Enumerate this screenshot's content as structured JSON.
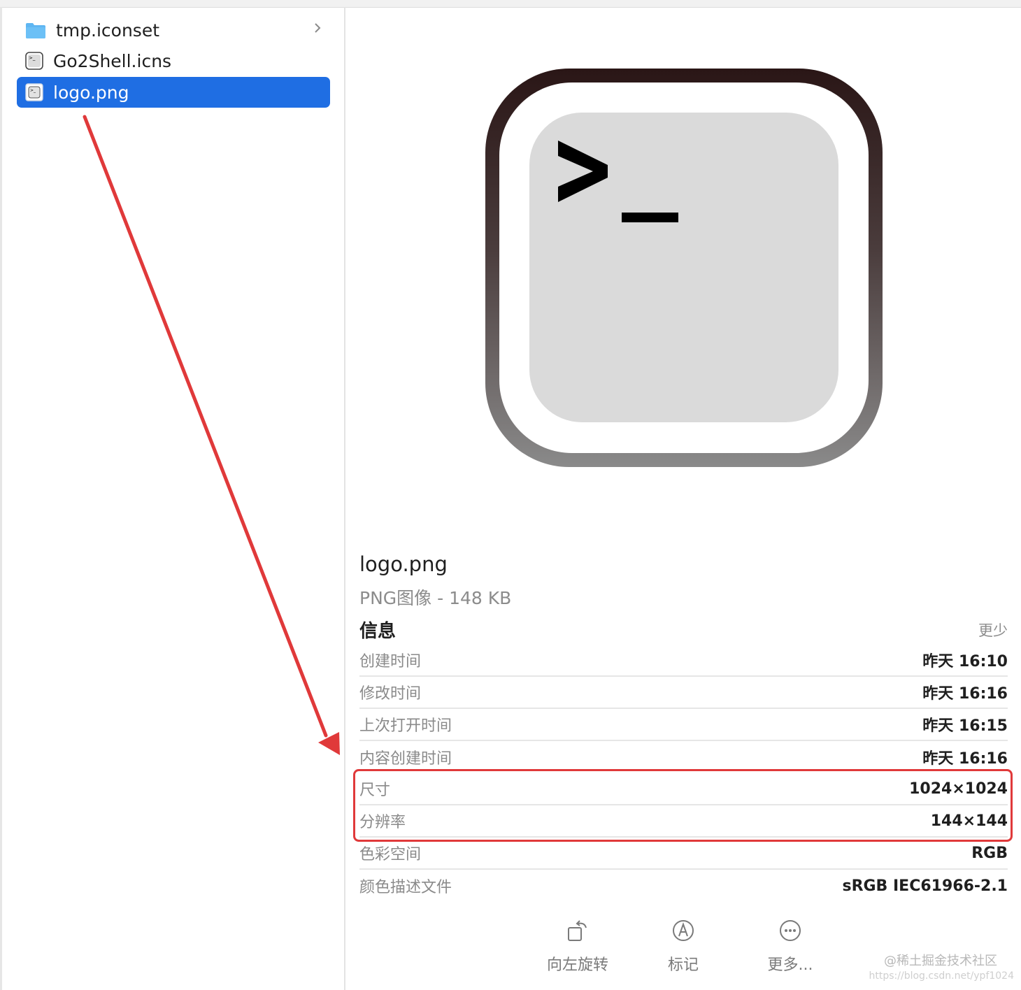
{
  "sidebar": {
    "items": [
      {
        "label": "tmp.iconset",
        "icon": "folder-icon",
        "has_chevron": true,
        "selected": false
      },
      {
        "label": "Go2Shell.icns",
        "icon": "icns-file-icon",
        "has_chevron": false,
        "selected": false
      },
      {
        "label": "logo.png",
        "icon": "png-file-icon",
        "selected": true
      }
    ]
  },
  "preview": {
    "icon": "terminal-prompt-icon",
    "prompt_text": ">_"
  },
  "details": {
    "title": "logo.png",
    "subtitle": "PNG图像 - 148 KB",
    "info_heading": "信息",
    "less_link": "更少",
    "rows": [
      {
        "key": "创建时间",
        "value": "昨天 16:10"
      },
      {
        "key": "修改时间",
        "value": "昨天 16:16"
      },
      {
        "key": "上次打开时间",
        "value": "昨天 16:15"
      },
      {
        "key": "内容创建时间",
        "value": "昨天 16:16"
      },
      {
        "key": "尺寸",
        "value": "1024×1024"
      },
      {
        "key": "分辨率",
        "value": "144×144"
      },
      {
        "key": "色彩空间",
        "value": "RGB"
      },
      {
        "key": "颜色描述文件",
        "value": "sRGB IEC61966-2.1"
      }
    ]
  },
  "actions": [
    {
      "label": "向左旋转",
      "icon": "rotate-left-icon"
    },
    {
      "label": "标记",
      "icon": "markup-icon"
    },
    {
      "label": "更多...",
      "icon": "more-icon"
    }
  ],
  "annotation": {
    "arrow_color": "#e0393a",
    "highlight_color": "#e0393a"
  },
  "watermark": {
    "line1": "@稀土掘金技术社区",
    "line2": "https://blog.csdn.net/ypf1024"
  },
  "colors": {
    "selection": "#1f6ee3",
    "folder": "#5fb6f2"
  }
}
